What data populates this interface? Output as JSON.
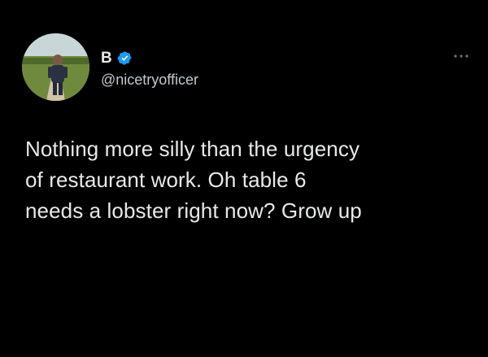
{
  "author": {
    "display_name": "B",
    "handle": "@nicetryofficer",
    "verified": true,
    "verified_color": "#1d9bf0"
  },
  "tweet": {
    "lines": [
      "Nothing more silly than the urgency",
      "of restaurant work. Oh table 6",
      "needs a lobster right now? Grow up"
    ]
  },
  "icons": {
    "verified": "verified-badge-icon",
    "more": "more-options-icon"
  },
  "colors": {
    "background": "#000000",
    "text": "#e7e9ea",
    "secondary_text": "#c4c8cc"
  }
}
